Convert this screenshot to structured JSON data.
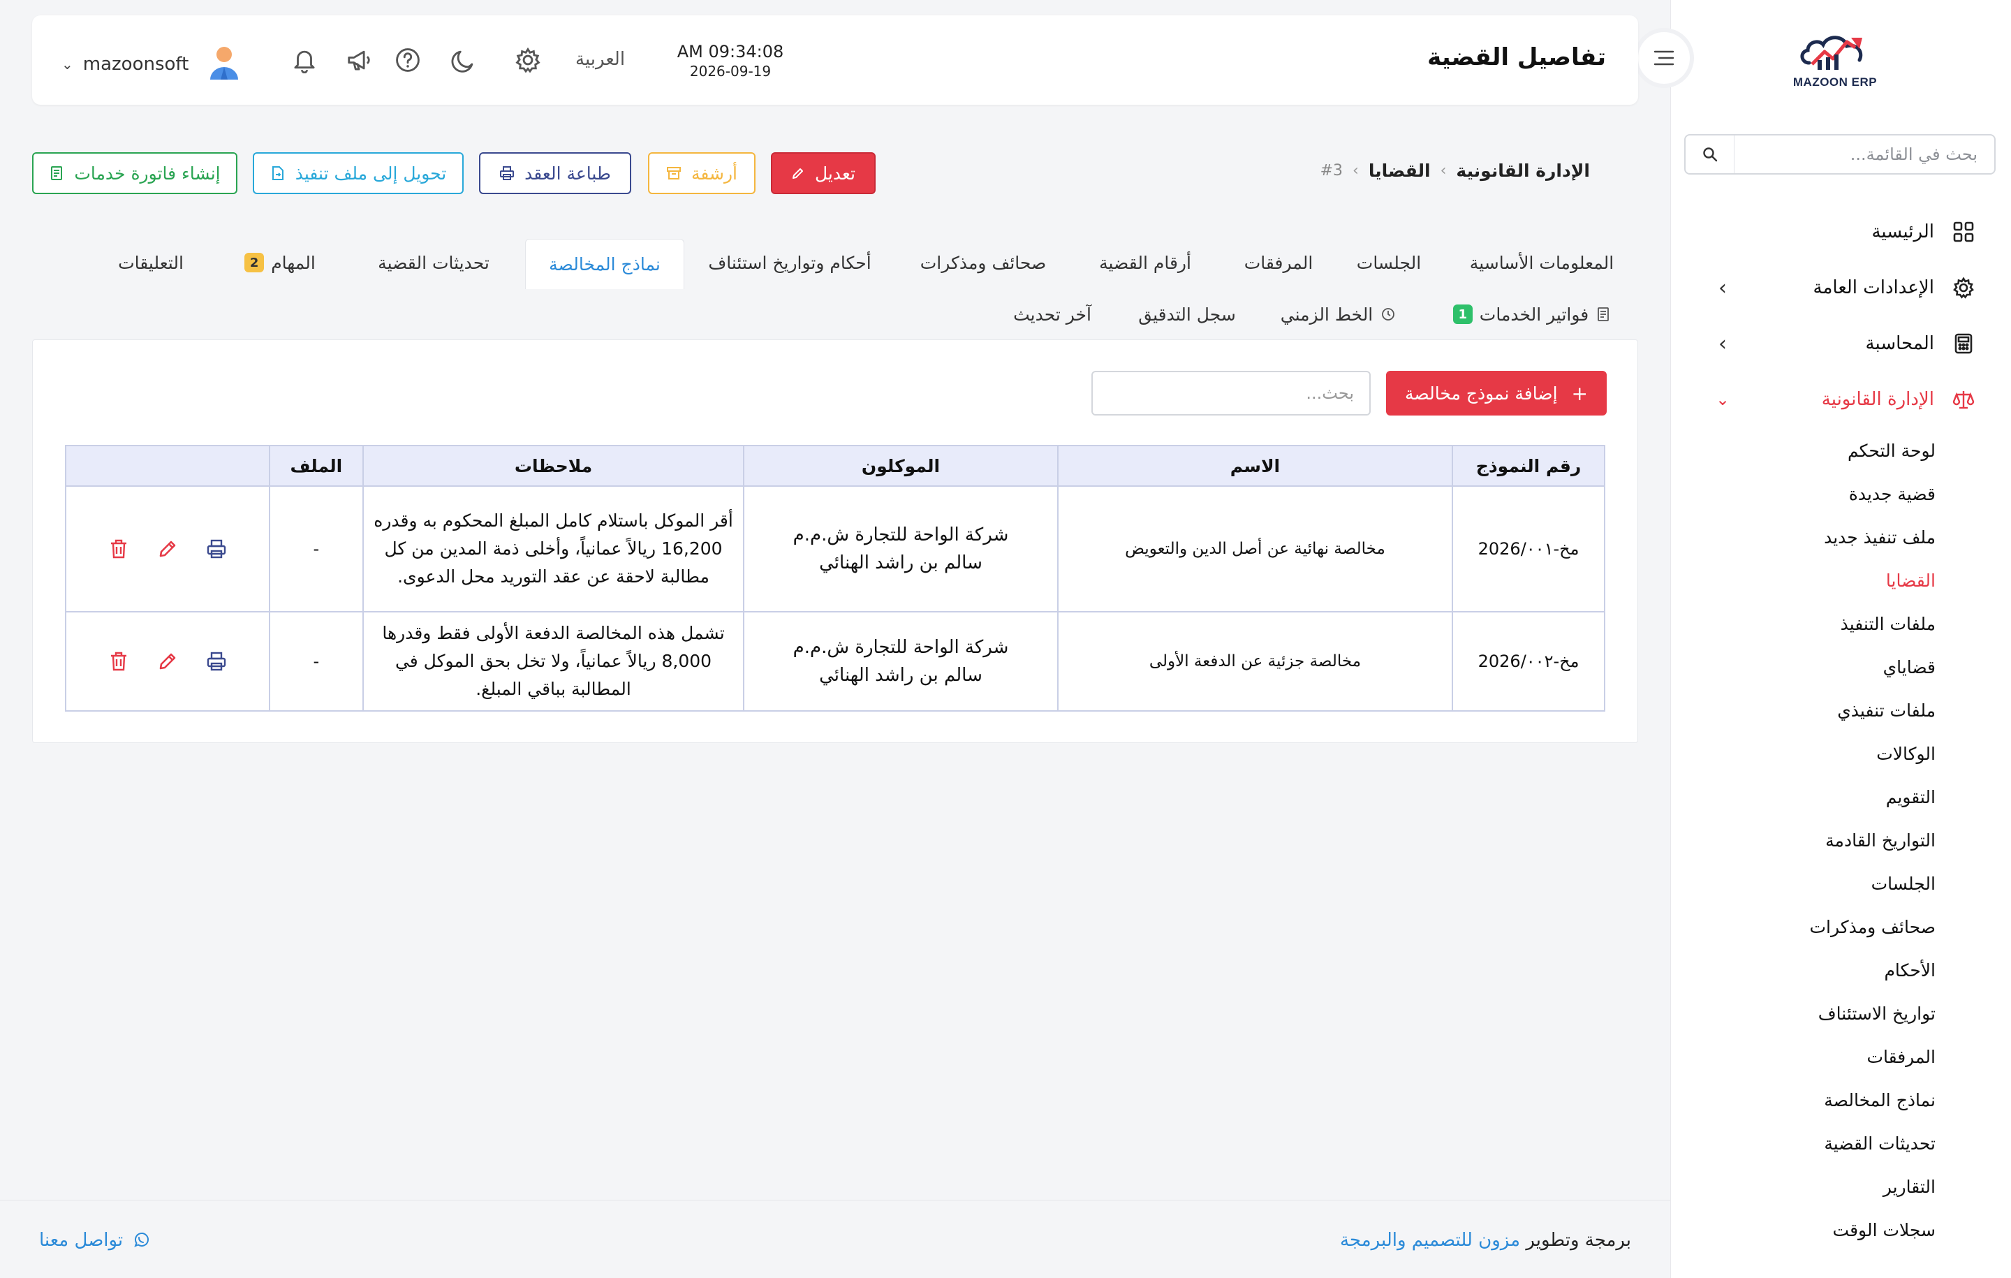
{
  "app": {
    "logo_text": "MAZOON ERP"
  },
  "sidebar": {
    "search_placeholder": "بحث في القائمة...",
    "items": [
      {
        "label": "الرئيسية",
        "icon": "grid-icon"
      },
      {
        "label": "الإعدادات العامة",
        "icon": "gear-icon"
      },
      {
        "label": "المحاسبة",
        "icon": "calculator-icon"
      },
      {
        "label": "الإدارة القانونية",
        "icon": "scale-icon"
      }
    ],
    "legal_sub": [
      "لوحة التحكم",
      "قضية جديدة",
      "ملف تنفيذ جديد",
      "القضايا",
      "ملفات التنفيذ",
      "قضاياي",
      "ملفات تنفيذي",
      "الوكالات",
      "التقويم",
      "التواريخ القادمة",
      "الجلسات",
      "صحائف ومذكرات",
      "الأحكام",
      "تواريخ الاستئناف",
      "المرفقات",
      "نماذج المخالصة",
      "تحديثات القضية",
      "التقارير",
      "سجلات الوقت"
    ],
    "active_color": "#e63946"
  },
  "header": {
    "title": "تفاصيل القضية",
    "time": "AM 09:34:08",
    "date": "2026-09-19",
    "language": "العربية",
    "username": "mazoonsoft"
  },
  "breadcrumb": {
    "root": "الإدارة القانونية",
    "section": "القضايا",
    "current": "#3"
  },
  "actions": {
    "edit": "تعديل",
    "archive": "أرشفة",
    "print_contract": "طباعة العقد",
    "convert": "تحويل إلى ملف تنفيذ",
    "invoice": "إنشاء فاتورة خدمات"
  },
  "tabs": {
    "basic": "المعلومات الأساسية",
    "sessions": "الجلسات",
    "attachments": "المرفقات",
    "case_numbers": "أرقام القضية",
    "pleadings": "صحائف ومذكرات",
    "judgments": "أحكام وتواريخ استئناف",
    "settlements": "نماذج المخالصة",
    "updates": "تحديثات القضية",
    "tasks": "المهام",
    "tasks_count": "2",
    "comments": "التعليقات",
    "invoices": "فواتير الخدمات",
    "invoices_count": "1",
    "timeline": "الخط الزمني",
    "audit": "سجل التدقيق",
    "last_update": "آخر تحديث"
  },
  "settlements": {
    "add_label": "إضافة نموذج مخالصة",
    "search_placeholder": "بحث...",
    "columns": [
      "رقم النموذج",
      "الاسم",
      "الموكلون",
      "ملاحظات",
      "الملف",
      ""
    ],
    "rows": [
      {
        "number": "مخ-2026/٠٠١",
        "name": "مخالصة نهائية عن أصل الدين والتعويض",
        "client1": "شركة الواحة للتجارة ش.م.م",
        "client2": "سالم بن راشد الهنائي",
        "notes": "أقر الموكل باستلام كامل المبلغ المحكوم به وقدره 16,200 ريالاً عمانياً، وأخلى ذمة المدين من كل مطالبة لاحقة عن عقد التوريد محل الدعوى.",
        "file": "-"
      },
      {
        "number": "مخ-2026/٠٠٢",
        "name": "مخالصة جزئية عن الدفعة الأولى",
        "client1": "شركة الواحة للتجارة ش.م.م",
        "client2": "سالم بن راشد الهنائي",
        "notes": "تشمل هذه المخالصة الدفعة الأولى فقط وقدرها 8,000 ريالاً عمانياً، ولا تخل بحق الموكل في المطالبة بباقي المبلغ.",
        "file": "-"
      }
    ]
  },
  "footer": {
    "credit_prefix": "برمجة وتطوير",
    "credit_link": "مزون للتصميم والبرمجة",
    "contact": "تواصل معنا"
  }
}
